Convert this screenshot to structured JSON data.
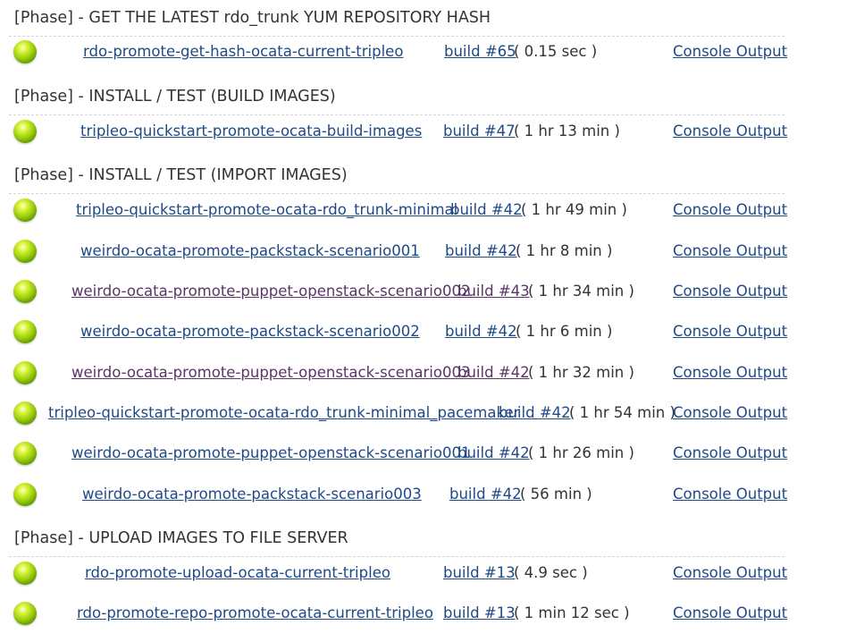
{
  "phases": [
    {
      "title": "[Phase] - GET THE LATEST rdo_trunk YUM REPOSITORY HASH",
      "jobs": [
        {
          "name": "rdo-promote-get-hash-ocata-current-tripleo",
          "build": "build #65",
          "duration": "( 0.15 sec )",
          "console": "Console Output",
          "status": "success"
        }
      ]
    },
    {
      "title": "[Phase] - INSTALL / TEST (BUILD IMAGES)",
      "jobs": [
        {
          "name": "tripleo-quickstart-promote-ocata-build-images",
          "build": "build #47",
          "duration": "( 1 hr 13 min )",
          "console": "Console Output",
          "status": "success"
        }
      ]
    },
    {
      "title": "[Phase] - INSTALL / TEST (IMPORT IMAGES)",
      "jobs": [
        {
          "name": "tripleo-quickstart-promote-ocata-rdo_trunk-minimal",
          "build": "build #42",
          "duration": "( 1 hr 49 min )",
          "console": "Console Output",
          "status": "success"
        },
        {
          "name": "weirdo-ocata-promote-packstack-scenario001",
          "build": "build #42",
          "duration": "( 1 hr 8 min )",
          "console": "Console Output",
          "status": "success"
        },
        {
          "name": "weirdo-ocata-promote-puppet-openstack-scenario002",
          "build": "build #43",
          "duration": "( 1 hr 34 min )",
          "console": "Console Output",
          "status": "success"
        },
        {
          "name": "weirdo-ocata-promote-packstack-scenario002",
          "build": "build #42",
          "duration": "( 1 hr 6 min )",
          "console": "Console Output",
          "status": "success"
        },
        {
          "name": "weirdo-ocata-promote-puppet-openstack-scenario003",
          "build": "build #42",
          "duration": "( 1 hr 32 min )",
          "console": "Console Output",
          "status": "success"
        },
        {
          "name": "tripleo-quickstart-promote-ocata-rdo_trunk-minimal_pacemaker",
          "build": "build #42",
          "duration": "( 1 hr 54 min )",
          "console": "Console Output",
          "status": "success"
        },
        {
          "name": "weirdo-ocata-promote-puppet-openstack-scenario001",
          "build": "build #42",
          "duration": "( 1 hr 26 min )",
          "console": "Console Output",
          "status": "success"
        },
        {
          "name": "weirdo-ocata-promote-packstack-scenario003",
          "build": "build #42",
          "duration": "( 56 min )",
          "console": "Console Output",
          "status": "success"
        }
      ]
    },
    {
      "title": "[Phase] - UPLOAD IMAGES TO FILE SERVER",
      "jobs": [
        {
          "name": "rdo-promote-upload-ocata-current-tripleo",
          "build": "build #13",
          "duration": "( 4.9 sec )",
          "console": "Console Output",
          "status": "success"
        },
        {
          "name": "rdo-promote-repo-promote-ocata-current-tripleo",
          "build": "build #13",
          "duration": "( 1 min 12 sec )",
          "console": "Console Output",
          "status": "success"
        }
      ]
    }
  ],
  "colors": {
    "link": "#204a87",
    "visited_link": "#5c3566",
    "success_ball": "#8fc40c",
    "divider": "#d4d4d4"
  }
}
